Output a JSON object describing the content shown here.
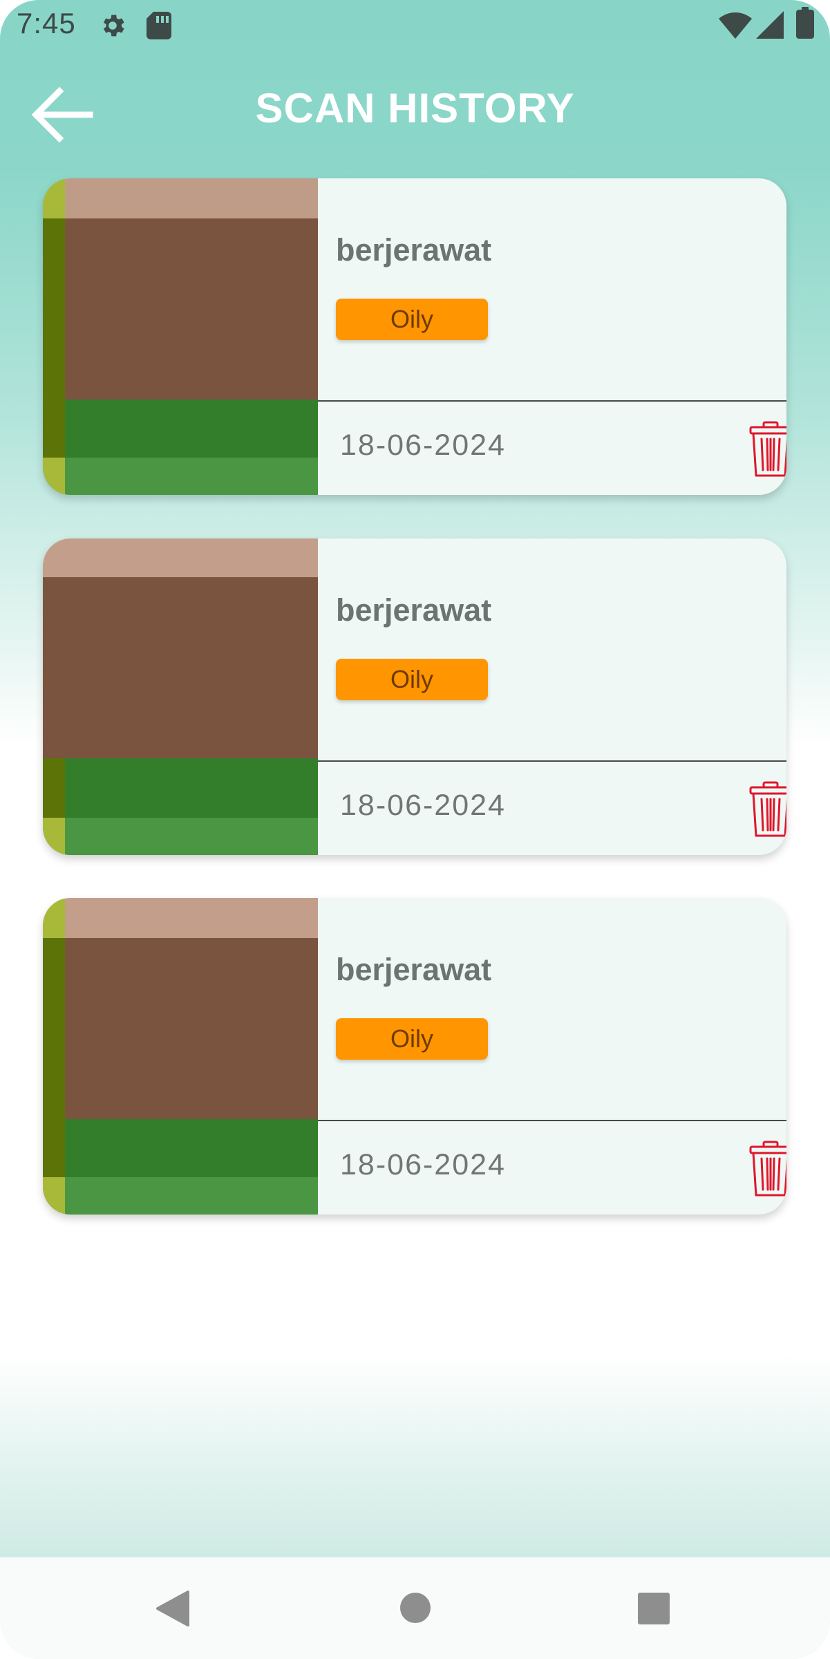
{
  "status_bar": {
    "time": "7:45",
    "icons": [
      "gear-icon",
      "sd-card-icon",
      "wifi-icon",
      "signal-icon",
      "battery-icon"
    ]
  },
  "app_bar": {
    "title": "SCAN HISTORY",
    "back_icon": "arrow-left-icon"
  },
  "history": {
    "items": [
      {
        "name": "berjerawat",
        "skin_type": "Oily",
        "date": "18-06-2024",
        "delete_icon": "trash-icon"
      },
      {
        "name": "berjerawat",
        "skin_type": "Oily",
        "date": "18-06-2024",
        "delete_icon": "trash-icon"
      },
      {
        "name": "berjerawat",
        "skin_type": "Oily",
        "date": "18-06-2024",
        "delete_icon": "trash-icon"
      }
    ]
  },
  "nav_bar": {
    "buttons": [
      "back-triangle-icon",
      "home-circle-icon",
      "recents-square-icon"
    ]
  },
  "colors": {
    "header_teal": "#88d5c8",
    "badge_orange": "#ff9500",
    "delete_red": "#e0162b",
    "card_background": "#eff8f5"
  }
}
